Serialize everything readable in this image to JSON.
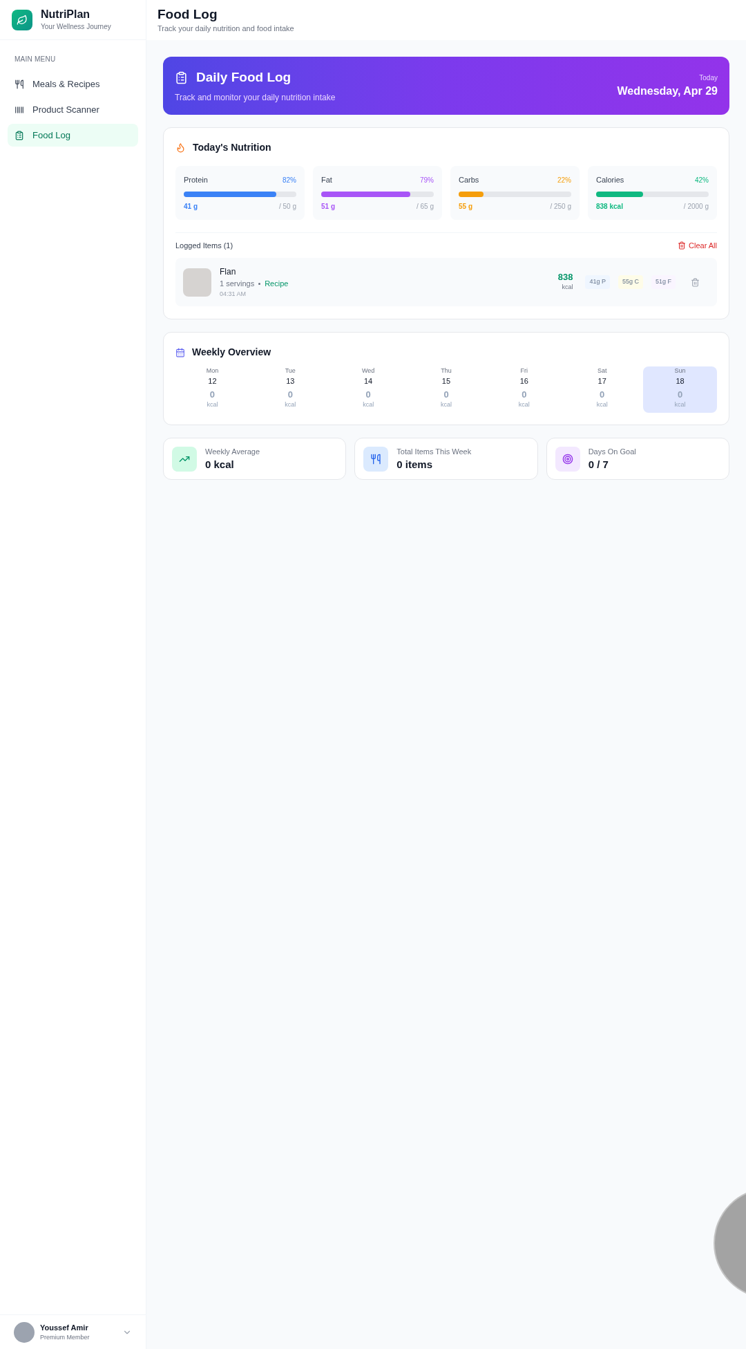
{
  "brand": {
    "name": "NutriPlan",
    "tagline": "Your Wellness Journey"
  },
  "sidebar": {
    "section": "MAIN MENU",
    "items": [
      {
        "label": "Meals & Recipes",
        "kind": "utensils",
        "selected": false
      },
      {
        "label": "Product Scanner",
        "kind": "barcode",
        "selected": false
      },
      {
        "label": "Food Log",
        "kind": "clipboard",
        "selected": true
      }
    ]
  },
  "user": {
    "name": "Youssef Amir",
    "role": "Premium Member"
  },
  "header": {
    "title": "Food Log",
    "subtitle": "Track your daily nutrition and food intake"
  },
  "banner": {
    "title": "Daily Food Log",
    "subtitle": "Track and monitor your daily nutrition intake",
    "date_label": "Today",
    "date": "Wednesday, Apr 29"
  },
  "nutrition": {
    "title": "Today's Nutrition",
    "macros": [
      {
        "name": "Protein",
        "percent": "82%",
        "level": 0.82,
        "color": "#3b82f6",
        "amount": "41 g",
        "goal": "/ 50 g"
      },
      {
        "name": "Fat",
        "percent": "79%",
        "level": 0.79,
        "color": "#a855f7",
        "amount": "51 g",
        "goal": "/ 65 g"
      },
      {
        "name": "Carbs",
        "percent": "22%",
        "level": 0.22,
        "color": "#f59e0b",
        "amount": "55 g",
        "goal": "/ 250 g"
      },
      {
        "name": "Calories",
        "percent": "42%",
        "level": 0.42,
        "color": "#10b981",
        "amount": "838 kcal",
        "goal": "/ 2000 g"
      }
    ],
    "logged_title": "Logged Items (1)",
    "clear_all": "Clear All",
    "items": [
      {
        "name": "Flan",
        "servings": "1 servings",
        "tag": "Recipe",
        "time": "04:31 AM",
        "kcal": "838",
        "kcal_unit": "kcal",
        "protein": "41g P",
        "carbs": "55g C",
        "fat": "51g F"
      }
    ]
  },
  "weekly": {
    "title": "Weekly Overview",
    "days": [
      {
        "day": "Mon",
        "date": "12",
        "value": "0",
        "unit": "kcal",
        "selected": false
      },
      {
        "day": "Tue",
        "date": "13",
        "value": "0",
        "unit": "kcal",
        "selected": false
      },
      {
        "day": "Wed",
        "date": "14",
        "value": "0",
        "unit": "kcal",
        "selected": false
      },
      {
        "day": "Thu",
        "date": "15",
        "value": "0",
        "unit": "kcal",
        "selected": false
      },
      {
        "day": "Fri",
        "date": "16",
        "value": "0",
        "unit": "kcal",
        "selected": false
      },
      {
        "day": "Sat",
        "date": "17",
        "value": "0",
        "unit": "kcal",
        "selected": false
      },
      {
        "day": "Sun",
        "date": "18",
        "value": "0",
        "unit": "kcal",
        "selected": true
      }
    ]
  },
  "stats": [
    {
      "kind": "chart",
      "label": "Weekly Average",
      "value": "0 kcal"
    },
    {
      "kind": "utensils",
      "label": "Total Items This Week",
      "value": "0 items"
    },
    {
      "kind": "target",
      "label": "Days On Goal",
      "value": "0 / 7"
    }
  ]
}
